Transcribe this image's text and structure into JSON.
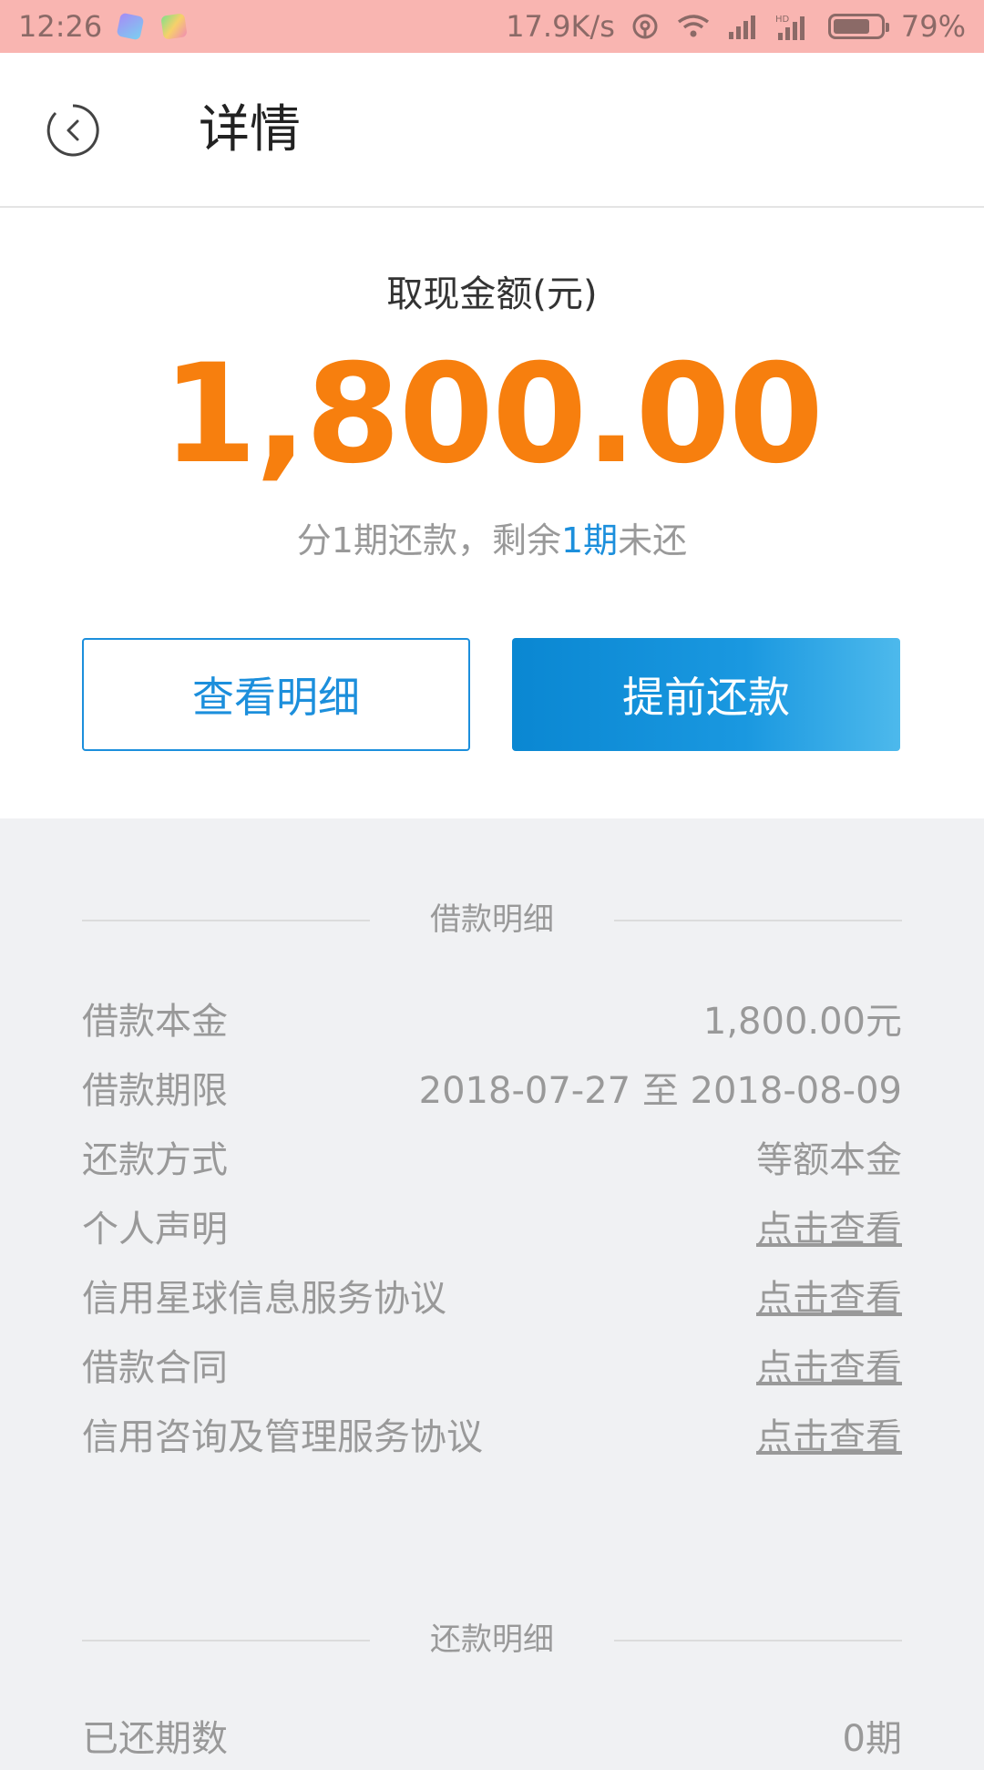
{
  "status_bar": {
    "time": "12:26",
    "network_speed": "17.9K/s",
    "battery_percent": "79%",
    "battery_level": 0.79
  },
  "header": {
    "title": "详情"
  },
  "summary": {
    "amount_label": "取现金额(元)",
    "amount": "1,800.00",
    "installment_prefix": "分1期还款，剩余",
    "installment_highlight": "1期",
    "installment_suffix": "未还",
    "view_detail_label": "查看明细",
    "prepay_label": "提前还款"
  },
  "loan_detail": {
    "title": "借款明细",
    "rows": [
      {
        "label": "借款本金",
        "value": "1,800.00元"
      },
      {
        "label": "借款期限",
        "value": "2018-07-27 至 2018-08-09"
      },
      {
        "label": "还款方式",
        "value": "等额本金"
      },
      {
        "label": "个人声明",
        "value": "点击查看"
      },
      {
        "label": "信用星球信息服务协议",
        "value": "点击查看"
      },
      {
        "label": "借款合同",
        "value": "点击查看"
      },
      {
        "label": "信用咨询及管理服务协议",
        "value": "点击查看"
      }
    ]
  },
  "repay_detail": {
    "title": "还款明细",
    "rows": [
      {
        "label": "已还期数",
        "value": "0期"
      }
    ]
  },
  "colors": {
    "accent_orange": "#f77f0e",
    "accent_blue": "#1c8fdc",
    "status_bar_bg": "#f9b5b1"
  }
}
